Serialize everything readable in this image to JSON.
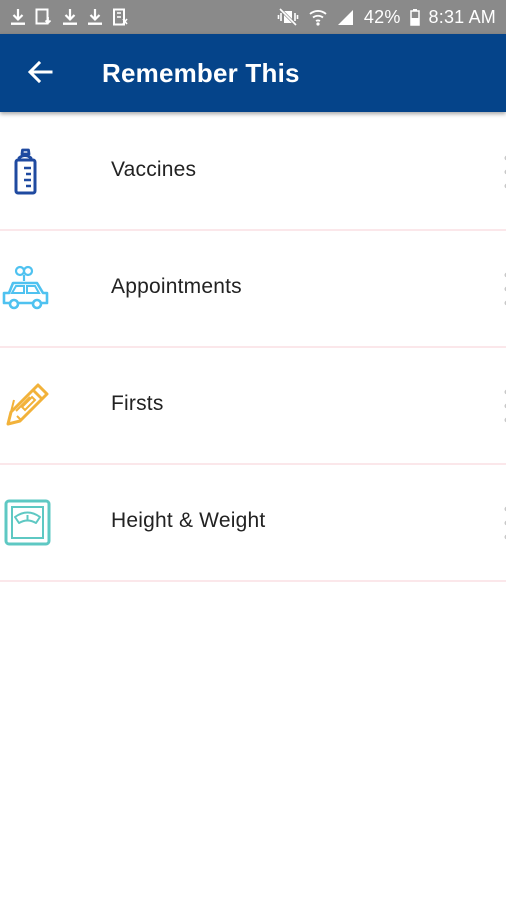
{
  "status_bar": {
    "battery": "42%",
    "time": "8:31 AM",
    "icons_left": [
      "download-icon",
      "image-download-icon",
      "download-icon",
      "download-icon",
      "book-icon"
    ],
    "icons_right": [
      "vibrate-mute-icon",
      "wifi-icon",
      "cellular-signal-icon",
      "battery-icon"
    ]
  },
  "app_bar": {
    "title": "Remember This",
    "back_icon": "arrow-left-icon",
    "color": "#05448a"
  },
  "list": {
    "items": [
      {
        "label": "Vaccines",
        "icon": "baby-bottle-icon",
        "color": "#1f4aa0"
      },
      {
        "label": "Appointments",
        "icon": "car-icon",
        "color": "#4fc2f0"
      },
      {
        "label": "Firsts",
        "icon": "pencil-icon",
        "color": "#f2b23a"
      },
      {
        "label": "Height & Weight",
        "icon": "scale-icon",
        "color": "#5ec8c3"
      }
    ],
    "divider_color": "#fbe7ea"
  }
}
